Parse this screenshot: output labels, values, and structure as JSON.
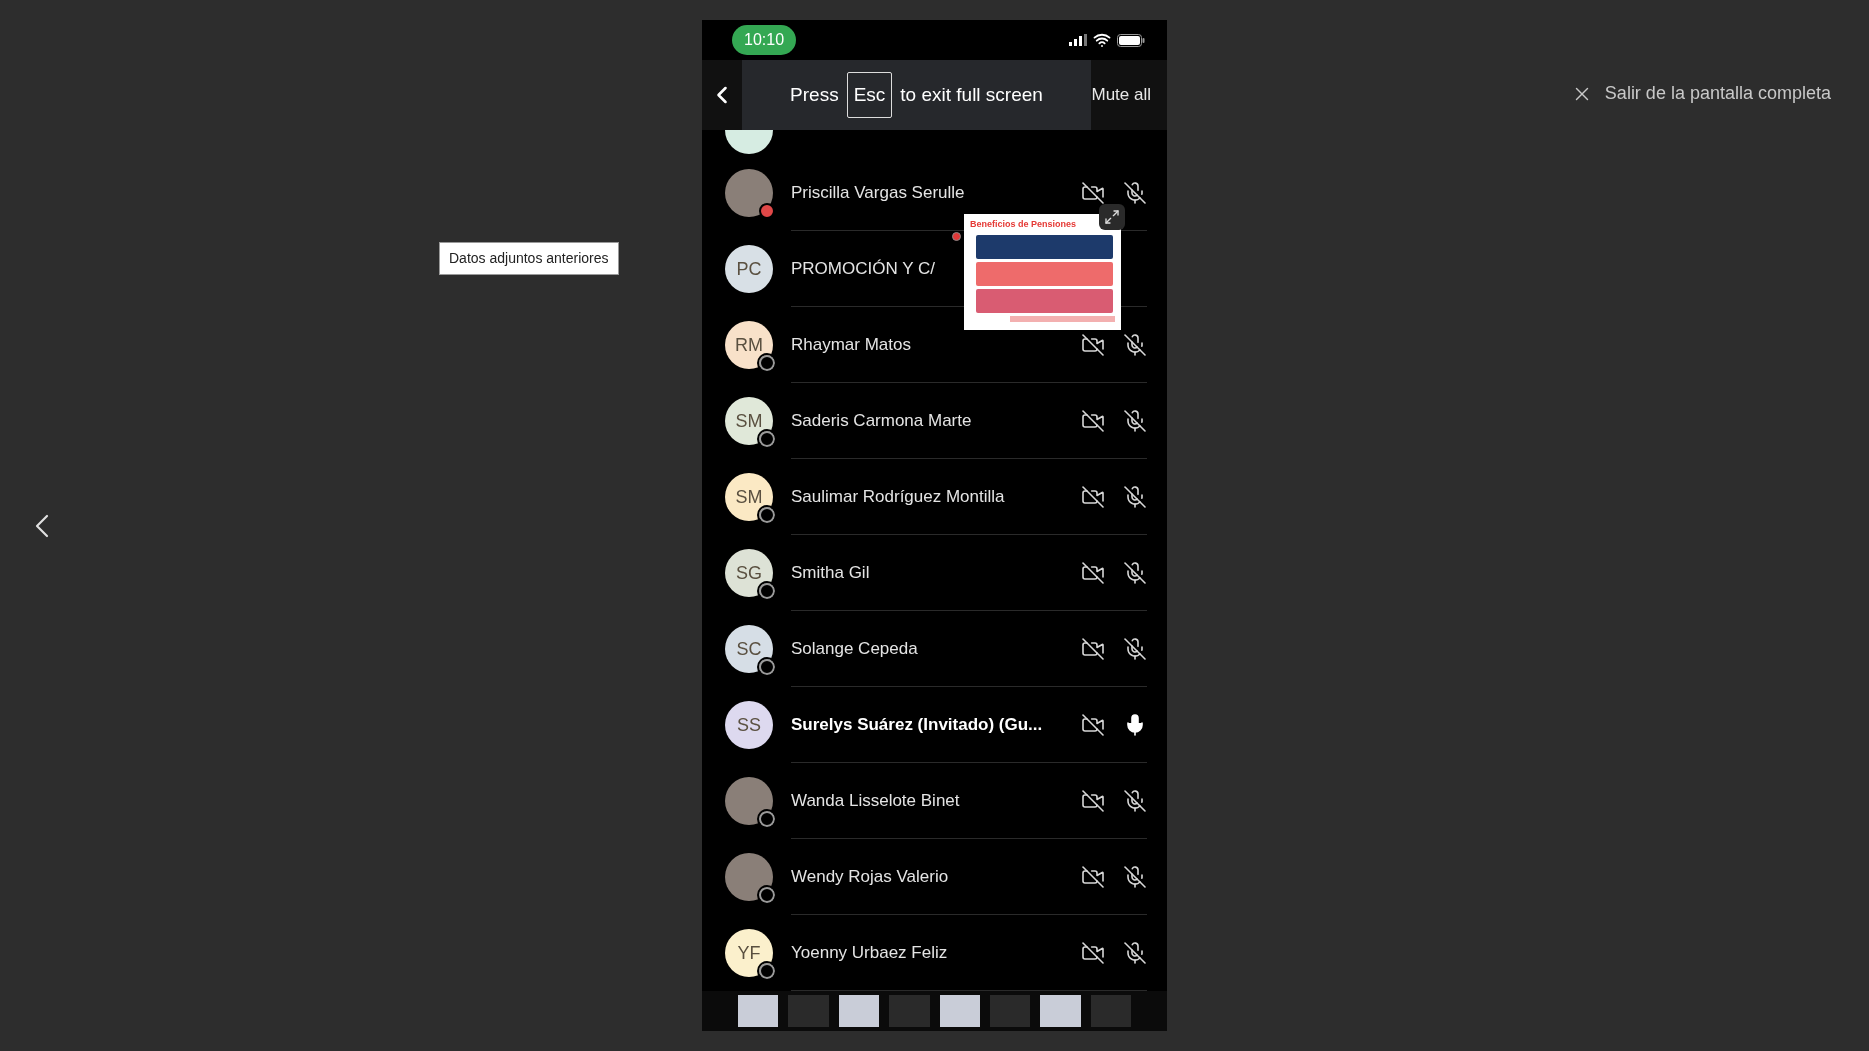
{
  "viewer": {
    "tooltip": "Datos adjuntos anteriores",
    "exit_fullscreen": "Salir de la pantalla completa"
  },
  "status_bar": {
    "time": "10:10"
  },
  "header": {
    "hint_before": "Press",
    "hint_key": "Esc",
    "hint_after": "to exit full screen",
    "mute_all": "Mute all"
  },
  "participants": [
    {
      "name": "Priscilla Vargas Serulle",
      "kind": "photo",
      "busy": true,
      "offline": false,
      "video_off": true,
      "mic_muted": true,
      "highlighted": false
    },
    {
      "name": "PROMOCIÓN Y C/",
      "kind": "initials",
      "initials": "PC",
      "color": "#d8e0e6",
      "busy": false,
      "offline": false,
      "highlighted": false
    },
    {
      "name": "Rhaymar Matos",
      "kind": "initials",
      "initials": "RM",
      "color": "#f8e1c9",
      "busy": false,
      "offline": true,
      "video_off": true,
      "mic_muted": true,
      "highlighted": false
    },
    {
      "name": "Saderis Carmona Marte",
      "kind": "initials",
      "initials": "SM",
      "color": "#e0e8d9",
      "busy": false,
      "offline": true,
      "video_off": true,
      "mic_muted": true,
      "highlighted": false
    },
    {
      "name": "Saulimar Rodríguez Montilla",
      "kind": "initials",
      "initials": "SM",
      "color": "#fbe9c4",
      "busy": false,
      "offline": true,
      "video_off": true,
      "mic_muted": true,
      "highlighted": false
    },
    {
      "name": "Smitha Gil",
      "kind": "initials",
      "initials": "SG",
      "color": "#dde2d6",
      "busy": false,
      "offline": true,
      "video_off": true,
      "mic_muted": true,
      "highlighted": false
    },
    {
      "name": "Solange Cepeda",
      "kind": "initials",
      "initials": "SC",
      "color": "#d6dee6",
      "busy": false,
      "offline": true,
      "video_off": true,
      "mic_muted": true,
      "highlighted": false
    },
    {
      "name": "Surelys Suárez (Invitado) (Gu...",
      "kind": "initials",
      "initials": "SS",
      "color": "#ddd9ef",
      "busy": false,
      "offline": false,
      "video_off": true,
      "mic_muted": false,
      "highlighted": true
    },
    {
      "name": "Wanda Lisselote Binet",
      "kind": "photo",
      "busy": false,
      "offline": true,
      "video_off": true,
      "mic_muted": true,
      "highlighted": false
    },
    {
      "name": "Wendy Rojas Valerio",
      "kind": "photo",
      "busy": false,
      "offline": true,
      "video_off": true,
      "mic_muted": true,
      "highlighted": false
    },
    {
      "name": "Yoenny Urbaez Feliz",
      "kind": "initials",
      "initials": "YF",
      "color": "#fbf0cc",
      "busy": false,
      "offline": true,
      "video_off": true,
      "mic_muted": true,
      "highlighted": false
    }
  ],
  "popup": {
    "slide_title": "Beneficios de Pensiones"
  }
}
